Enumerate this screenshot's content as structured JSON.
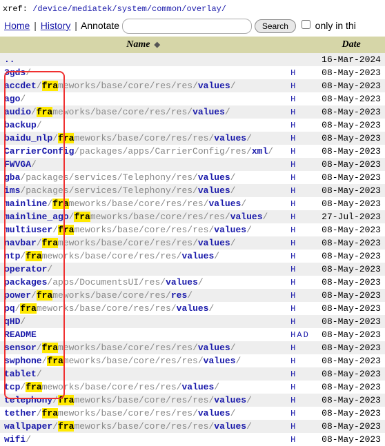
{
  "xref_label": "xref: ",
  "xref_path": "/device/mediatek/system/common/overlay/",
  "toolbar": {
    "home": "Home",
    "history": "History",
    "annotate": "Annotate",
    "search_btn": "Search",
    "only_in": " only in thi"
  },
  "headers": {
    "name": "Name",
    "date": "Date"
  },
  "rows": [
    {
      "segs": [
        {
          "t": "..",
          "c": "bold"
        }
      ],
      "links": "",
      "date": "16-Mar-2024"
    },
    {
      "segs": [
        {
          "t": "3gds",
          "c": "bold"
        },
        {
          "t": "/",
          "c": "gray"
        }
      ],
      "links": "H",
      "date": "08-May-2023"
    },
    {
      "segs": [
        {
          "t": "accdet",
          "c": "bold"
        },
        {
          "t": "/",
          "c": "gray"
        },
        {
          "t": "fra",
          "c": "hl"
        },
        {
          "t": "meworks/base/core/res/res/",
          "c": "gray"
        },
        {
          "t": "values",
          "c": "bold"
        },
        {
          "t": "/",
          "c": "gray"
        }
      ],
      "links": "H",
      "date": "08-May-2023"
    },
    {
      "segs": [
        {
          "t": "ago",
          "c": "bold"
        },
        {
          "t": "/",
          "c": "gray"
        }
      ],
      "links": "H",
      "date": "08-May-2023"
    },
    {
      "segs": [
        {
          "t": "audio",
          "c": "bold"
        },
        {
          "t": "/",
          "c": "gray"
        },
        {
          "t": "fra",
          "c": "hl"
        },
        {
          "t": "meworks/base/core/res/res/",
          "c": "gray"
        },
        {
          "t": "values",
          "c": "bold"
        },
        {
          "t": "/",
          "c": "gray"
        }
      ],
      "links": "H",
      "date": "08-May-2023"
    },
    {
      "segs": [
        {
          "t": "backup",
          "c": "bold"
        },
        {
          "t": "/",
          "c": "gray"
        }
      ],
      "links": "H",
      "date": "08-May-2023"
    },
    {
      "segs": [
        {
          "t": "baidu_nlp",
          "c": "bold"
        },
        {
          "t": "/",
          "c": "gray"
        },
        {
          "t": "fra",
          "c": "hl"
        },
        {
          "t": "meworks/base/core/res/res/",
          "c": "gray"
        },
        {
          "t": "values",
          "c": "bold"
        },
        {
          "t": "/",
          "c": "gray"
        }
      ],
      "links": "H",
      "date": "08-May-2023"
    },
    {
      "segs": [
        {
          "t": "CarrierConfig",
          "c": "bold"
        },
        {
          "t": "/packages/apps/CarrierConfig/res/",
          "c": "gray"
        },
        {
          "t": "xml",
          "c": "bold"
        },
        {
          "t": "/",
          "c": "gray"
        }
      ],
      "links": "H",
      "date": "08-May-2023"
    },
    {
      "segs": [
        {
          "t": "FWVGA",
          "c": "bold"
        },
        {
          "t": "/",
          "c": "gray"
        }
      ],
      "links": "H",
      "date": "08-May-2023"
    },
    {
      "segs": [
        {
          "t": "gba",
          "c": "bold"
        },
        {
          "t": "/packages/services/Telephony/res/",
          "c": "gray"
        },
        {
          "t": "values",
          "c": "bold"
        },
        {
          "t": "/",
          "c": "gray"
        }
      ],
      "links": "H",
      "date": "08-May-2023"
    },
    {
      "segs": [
        {
          "t": "ims",
          "c": "bold"
        },
        {
          "t": "/packages/services/Telephony/res/",
          "c": "gray"
        },
        {
          "t": "values",
          "c": "bold"
        },
        {
          "t": "/",
          "c": "gray"
        }
      ],
      "links": "H",
      "date": "08-May-2023"
    },
    {
      "segs": [
        {
          "t": "mainline",
          "c": "bold"
        },
        {
          "t": "/",
          "c": "gray"
        },
        {
          "t": "fra",
          "c": "hl"
        },
        {
          "t": "meworks/base/core/res/res/",
          "c": "gray"
        },
        {
          "t": "values",
          "c": "bold"
        },
        {
          "t": "/",
          "c": "gray"
        }
      ],
      "links": "H",
      "date": "08-May-2023"
    },
    {
      "segs": [
        {
          "t": "mainline_ago",
          "c": "bold"
        },
        {
          "t": "/",
          "c": "gray"
        },
        {
          "t": "fra",
          "c": "hl"
        },
        {
          "t": "meworks/base/core/res/res/",
          "c": "gray"
        },
        {
          "t": "values",
          "c": "bold"
        },
        {
          "t": "/",
          "c": "gray"
        }
      ],
      "links": "H",
      "date": "27-Jul-2023"
    },
    {
      "segs": [
        {
          "t": "multiuser",
          "c": "bold"
        },
        {
          "t": "/",
          "c": "gray"
        },
        {
          "t": "fra",
          "c": "hl"
        },
        {
          "t": "meworks/base/core/res/res/",
          "c": "gray"
        },
        {
          "t": "values",
          "c": "bold"
        },
        {
          "t": "/",
          "c": "gray"
        }
      ],
      "links": "H",
      "date": "08-May-2023"
    },
    {
      "segs": [
        {
          "t": "navbar",
          "c": "bold"
        },
        {
          "t": "/",
          "c": "gray"
        },
        {
          "t": "fra",
          "c": "hl"
        },
        {
          "t": "meworks/base/core/res/res/",
          "c": "gray"
        },
        {
          "t": "values",
          "c": "bold"
        },
        {
          "t": "/",
          "c": "gray"
        }
      ],
      "links": "H",
      "date": "08-May-2023"
    },
    {
      "segs": [
        {
          "t": "ntp",
          "c": "bold"
        },
        {
          "t": "/",
          "c": "gray"
        },
        {
          "t": "fra",
          "c": "hl"
        },
        {
          "t": "meworks/base/core/res/res/",
          "c": "gray"
        },
        {
          "t": "values",
          "c": "bold"
        },
        {
          "t": "/",
          "c": "gray"
        }
      ],
      "links": "H",
      "date": "08-May-2023"
    },
    {
      "segs": [
        {
          "t": "operator",
          "c": "bold"
        },
        {
          "t": "/",
          "c": "gray"
        }
      ],
      "links": "H",
      "date": "08-May-2023"
    },
    {
      "segs": [
        {
          "t": "packages",
          "c": "bold"
        },
        {
          "t": "/apps/DocumentsUI/res/",
          "c": "gray"
        },
        {
          "t": "values",
          "c": "bold"
        },
        {
          "t": "/",
          "c": "gray"
        }
      ],
      "links": "H",
      "date": "08-May-2023"
    },
    {
      "segs": [
        {
          "t": "power",
          "c": "bold"
        },
        {
          "t": "/",
          "c": "gray"
        },
        {
          "t": "fra",
          "c": "hl"
        },
        {
          "t": "meworks/base/core/res/",
          "c": "gray"
        },
        {
          "t": "res",
          "c": "bold"
        },
        {
          "t": "/",
          "c": "gray"
        }
      ],
      "links": "H",
      "date": "08-May-2023"
    },
    {
      "segs": [
        {
          "t": "pq",
          "c": "bold"
        },
        {
          "t": "/",
          "c": "gray"
        },
        {
          "t": "fra",
          "c": "hl"
        },
        {
          "t": "meworks/base/core/res/res/",
          "c": "gray"
        },
        {
          "t": "values",
          "c": "bold"
        },
        {
          "t": "/",
          "c": "gray"
        }
      ],
      "links": "H",
      "date": "08-May-2023"
    },
    {
      "segs": [
        {
          "t": "qHD",
          "c": "bold"
        },
        {
          "t": "/",
          "c": "gray"
        }
      ],
      "links": "H",
      "date": "08-May-2023"
    },
    {
      "segs": [
        {
          "t": "README",
          "c": "bold"
        }
      ],
      "links": "H A D",
      "date": "08-May-2023"
    },
    {
      "segs": [
        {
          "t": "sensor",
          "c": "bold"
        },
        {
          "t": "/",
          "c": "gray"
        },
        {
          "t": "fra",
          "c": "hl"
        },
        {
          "t": "meworks/base/core/res/res/",
          "c": "gray"
        },
        {
          "t": "values",
          "c": "bold"
        },
        {
          "t": "/",
          "c": "gray"
        }
      ],
      "links": "H",
      "date": "08-May-2023"
    },
    {
      "segs": [
        {
          "t": "swphone",
          "c": "bold"
        },
        {
          "t": "/",
          "c": "gray"
        },
        {
          "t": "fra",
          "c": "hl"
        },
        {
          "t": "meworks/base/core/res/res/",
          "c": "gray"
        },
        {
          "t": "values",
          "c": "bold"
        },
        {
          "t": "/",
          "c": "gray"
        }
      ],
      "links": "H",
      "date": "08-May-2023"
    },
    {
      "segs": [
        {
          "t": "tablet",
          "c": "bold"
        },
        {
          "t": "/",
          "c": "gray"
        }
      ],
      "links": "H",
      "date": "08-May-2023"
    },
    {
      "segs": [
        {
          "t": "tcp",
          "c": "bold"
        },
        {
          "t": "/",
          "c": "gray"
        },
        {
          "t": "fra",
          "c": "hl"
        },
        {
          "t": "meworks/base/core/res/res/",
          "c": "gray"
        },
        {
          "t": "values",
          "c": "bold"
        },
        {
          "t": "/",
          "c": "gray"
        }
      ],
      "links": "H",
      "date": "08-May-2023"
    },
    {
      "segs": [
        {
          "t": "telephony",
          "c": "bold"
        },
        {
          "t": "/",
          "c": "gray"
        },
        {
          "t": "fra",
          "c": "hl"
        },
        {
          "t": "meworks/base/core/res/res/",
          "c": "gray"
        },
        {
          "t": "values",
          "c": "bold"
        },
        {
          "t": "/",
          "c": "gray"
        }
      ],
      "links": "H",
      "date": "08-May-2023"
    },
    {
      "segs": [
        {
          "t": "tether",
          "c": "bold"
        },
        {
          "t": "/",
          "c": "gray"
        },
        {
          "t": "fra",
          "c": "hl"
        },
        {
          "t": "meworks/base/core/res/res/",
          "c": "gray"
        },
        {
          "t": "values",
          "c": "bold"
        },
        {
          "t": "/",
          "c": "gray"
        }
      ],
      "links": "H",
      "date": "08-May-2023"
    },
    {
      "segs": [
        {
          "t": "wallpaper",
          "c": "bold"
        },
        {
          "t": "/",
          "c": "gray"
        },
        {
          "t": "fra",
          "c": "hl"
        },
        {
          "t": "meworks/base/core/res/res/",
          "c": "gray"
        },
        {
          "t": "values",
          "c": "bold"
        },
        {
          "t": "/",
          "c": "gray"
        }
      ],
      "links": "H",
      "date": "08-May-2023"
    },
    {
      "segs": [
        {
          "t": "wifi",
          "c": "bold"
        },
        {
          "t": "/",
          "c": "gray"
        }
      ],
      "links": "H",
      "date": "08-May-2023"
    }
  ]
}
